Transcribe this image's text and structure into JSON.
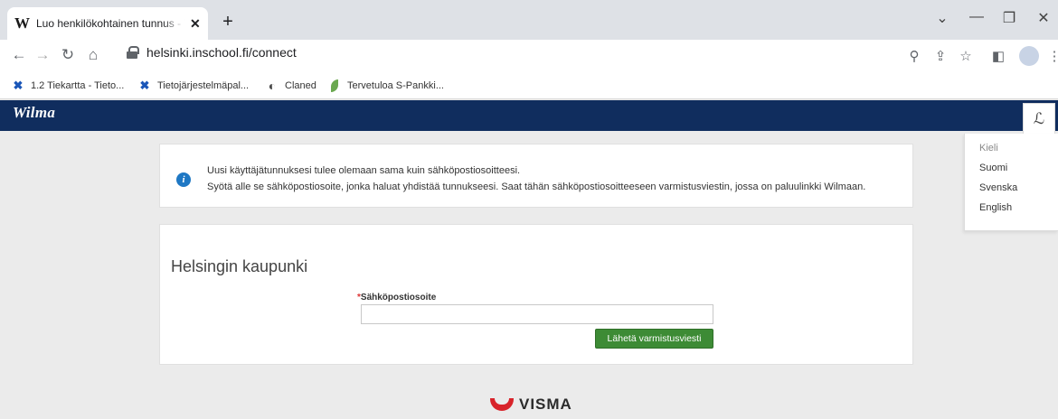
{
  "browser": {
    "tab_title": "Luo henkilökohtainen tunnus - Wilma",
    "tab_favicon": "W",
    "new_tab_label": "+",
    "close_label": "✕",
    "url": "helsinki.inschool.fi/connect",
    "bookmarks": [
      {
        "label": "1.2 Tiekartta - Tieto...",
        "icon": "x-icon"
      },
      {
        "label": "Tietojärjestelmäpal...",
        "icon": "x-icon"
      },
      {
        "label": "Claned",
        "icon": "claned-icon"
      },
      {
        "label": "Tervetuloa S-Pankki...",
        "icon": "leaf-icon"
      }
    ]
  },
  "wilma": {
    "logo": "Wilma",
    "lang_button_icon": "ℒ",
    "lang_menu": {
      "heading": "Kieli",
      "options": [
        "Suomi",
        "Svenska",
        "English"
      ]
    },
    "info": {
      "icon": "i",
      "line1": "Uusi käyttäjätunnuksesi tulee olemaan sama kuin sähköpostiosoitteesi.",
      "line2": "Syötä alle se sähköpostiosoite, jonka haluat yhdistää tunnukseesi. Saat tähän sähköpostiosoitteeseen varmistusviestin, jossa on paluulinkki Wilmaan."
    },
    "form": {
      "org_name": "Helsingin kaupunki",
      "required_mark": "*",
      "email_label": "Sähköpostiosoite",
      "email_value": "",
      "submit_label": "Lähetä varmistusviesti"
    },
    "footer_brand": "VISMA"
  },
  "colors": {
    "wilma_header": "#102d5e",
    "submit_button": "#3d8b35",
    "info_icon": "#1f78c4",
    "visma_red": "#d8232a"
  }
}
